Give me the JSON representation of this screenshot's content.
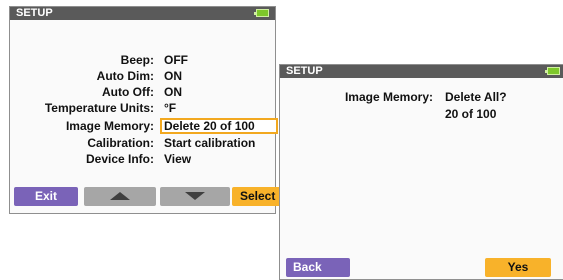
{
  "screen1": {
    "title": "SETUP",
    "battery_icon": "battery-full-icon",
    "settings": [
      {
        "label": "Beep:",
        "value": "OFF"
      },
      {
        "label": "Auto Dim:",
        "value": "ON"
      },
      {
        "label": "Auto Off:",
        "value": "ON"
      },
      {
        "label": "Temperature Units:",
        "value": "°F"
      },
      {
        "label": "Image Memory:",
        "value": "Delete 20 of 100"
      },
      {
        "label": "Calibration:",
        "value": "Start calibration"
      },
      {
        "label": "Device Info:",
        "value": "View"
      }
    ],
    "softkeys": {
      "exit": "Exit",
      "up_icon": "up-arrow-icon",
      "down_icon": "down-arrow-icon",
      "select": "Select"
    }
  },
  "screen2": {
    "title": "SETUP",
    "battery_icon": "battery-full-icon",
    "label": "Image Memory:",
    "value_line1": "Delete All?",
    "value_line2": "20 of 100",
    "softkeys": {
      "back": "Back",
      "yes": "Yes"
    }
  },
  "colors": {
    "title_bar": "#5a5a5a",
    "softkey_purple": "#7a63b8",
    "softkey_gray": "#a6a6a6",
    "softkey_orange": "#f8b22a",
    "highlight_border": "#f2a81f",
    "battery": "#7ec82a"
  }
}
